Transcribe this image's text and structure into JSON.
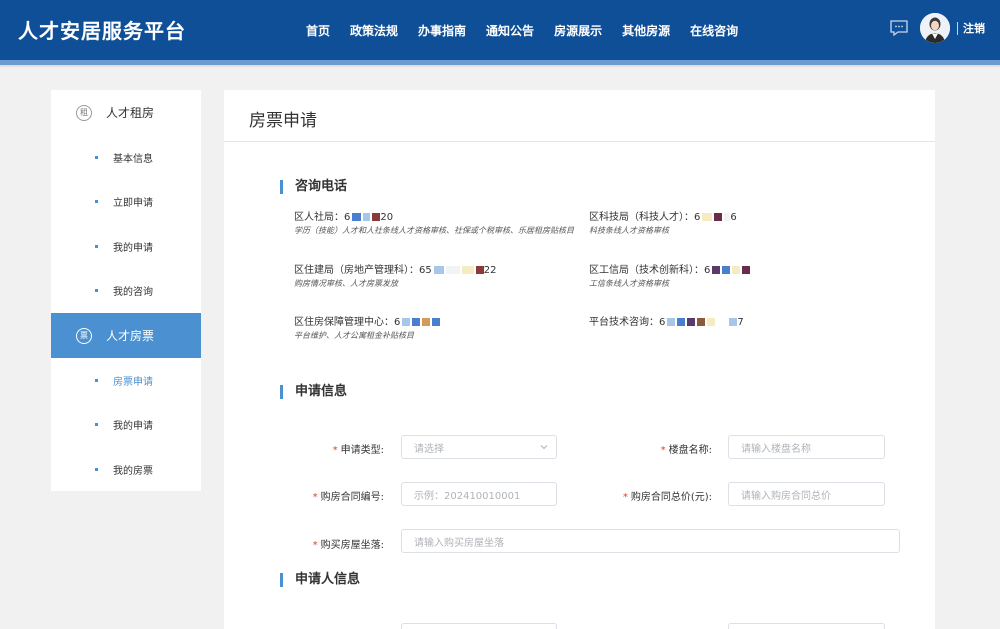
{
  "header": {
    "logo": "人才安居服务平台",
    "nav": [
      "首页",
      "政策法规",
      "办事指南",
      "通知公告",
      "房源展示",
      "其他房源",
      "在线咨询"
    ],
    "logout": "注销"
  },
  "sidebar": {
    "group1": {
      "icon_char": "租",
      "label": "人才租房"
    },
    "group1_items": [
      "基本信息",
      "立即申请",
      "我的申请",
      "我的咨询"
    ],
    "group2": {
      "icon_char": "票",
      "label": "人才房票"
    },
    "group2_items": [
      "房票申请",
      "我的申请",
      "我的房票"
    ]
  },
  "main": {
    "title": "房票申请",
    "consult": {
      "title": "咨询电话",
      "contacts": [
        {
          "label": "区人社局：6",
          "tail": "20",
          "desc": "学历（技能）人才和人社条线人才资格审核、社保或个税审核、乐居租房贴核目"
        },
        {
          "label": "区科技局（科技人才）：6",
          "tail": "6",
          "desc": "科技条线人才资格审核"
        },
        {
          "label": "区住建局（房地产管理科）：65",
          "tail": "22",
          "desc": "购房情况审核、人才房票发放"
        },
        {
          "label": "区工信局（技术创新科）：6",
          "tail": "",
          "desc": "工信条线人才资格审核"
        },
        {
          "label": "区住房保障管理中心：6",
          "tail": "",
          "desc": "平台维护、人才公寓租金补贴核目"
        },
        {
          "label": "平台技术咨询：6",
          "tail": "7",
          "desc": ""
        }
      ]
    },
    "apply": {
      "title": "申请信息",
      "type_label": "申请类型:",
      "type_placeholder": "请选择",
      "estate_label": "楼盘名称:",
      "estate_placeholder": "请输入楼盘名称",
      "contract_no_label": "购房合同编号:",
      "contract_no_placeholder": "示例：202410010001",
      "contract_price_label": "购房合同总价(元):",
      "contract_price_placeholder": "请输入购房合同总价",
      "address_label": "购买房屋坐落:",
      "address_placeholder": "请输入购买房屋坐落"
    },
    "applicant": {
      "title": "申请人信息"
    }
  },
  "colors": {
    "header": "#0f4f97",
    "accent": "#4b90d0",
    "required": "#e2402b"
  }
}
